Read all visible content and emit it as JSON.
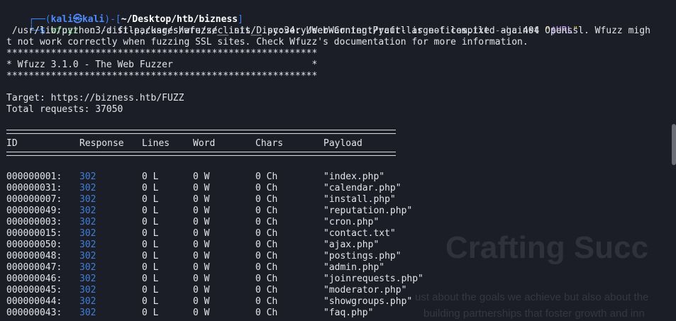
{
  "prompt": {
    "corner_top": "┌──",
    "user": "kali",
    "at": "㉿",
    "host": "kali",
    "dash": "-",
    "path": "~/Desktop/htb/bizness",
    "corner_bottom": "└─",
    "dollar": "$",
    "cmd_name": "wfuzz",
    "flag_c": "-c",
    "flag_z": "-z",
    "wordlist": "file,/usr/share/seclists/Discovery/Web-Content/raft-large-files.txt",
    "flag_hc": "--hc",
    "hc_value": "404",
    "url_quote_open": "\"",
    "url_var": "$URL",
    "url_quote_close": "\""
  },
  "output": {
    "warning_line1": " /usr/lib/python3/dist-packages/wfuzz/__init__.py:34: UserWarning:Pycurl is not compiled against Openssl. Wfuzz migh",
    "warning_line2": "t not work correctly when fuzzing SSL sites. Check Wfuzz's documentation for more information.",
    "banner_stars": "********************************************************",
    "banner_title": "* Wfuzz 3.1.0 - The Web Fuzzer                         *",
    "target": "Target: https://bizness.htb/FUZZ",
    "total": "Total requests: 37050"
  },
  "table": {
    "headers": {
      "id": "ID",
      "response": "Response",
      "lines": "Lines",
      "word": "Word",
      "chars": "Chars",
      "payload": "Payload"
    },
    "rows": [
      {
        "id": "000000001:",
        "response": "302",
        "lines": "0 L",
        "word": "0 W",
        "chars": "0 Ch",
        "payload": "\"index.php\""
      },
      {
        "id": "000000031:",
        "response": "302",
        "lines": "0 L",
        "word": "0 W",
        "chars": "0 Ch",
        "payload": "\"calendar.php\""
      },
      {
        "id": "000000007:",
        "response": "302",
        "lines": "0 L",
        "word": "0 W",
        "chars": "0 Ch",
        "payload": "\"install.php\""
      },
      {
        "id": "000000049:",
        "response": "302",
        "lines": "0 L",
        "word": "0 W",
        "chars": "0 Ch",
        "payload": "\"reputation.php\""
      },
      {
        "id": "000000003:",
        "response": "302",
        "lines": "0 L",
        "word": "0 W",
        "chars": "0 Ch",
        "payload": "\"cron.php\""
      },
      {
        "id": "000000015:",
        "response": "302",
        "lines": "0 L",
        "word": "0 W",
        "chars": "0 Ch",
        "payload": "\"contact.txt\""
      },
      {
        "id": "000000050:",
        "response": "302",
        "lines": "0 L",
        "word": "0 W",
        "chars": "0 Ch",
        "payload": "\"ajax.php\""
      },
      {
        "id": "000000048:",
        "response": "302",
        "lines": "0 L",
        "word": "0 W",
        "chars": "0 Ch",
        "payload": "\"postings.php\""
      },
      {
        "id": "000000047:",
        "response": "302",
        "lines": "0 L",
        "word": "0 W",
        "chars": "0 Ch",
        "payload": "\"admin.php\""
      },
      {
        "id": "000000046:",
        "response": "302",
        "lines": "0 L",
        "word": "0 W",
        "chars": "0 Ch",
        "payload": "\"joinrequests.php\""
      },
      {
        "id": "000000045:",
        "response": "302",
        "lines": "0 L",
        "word": "0 W",
        "chars": "0 Ch",
        "payload": "\"moderator.php\""
      },
      {
        "id": "000000044:",
        "response": "302",
        "lines": "0 L",
        "word": "0 W",
        "chars": "0 Ch",
        "payload": "\"showgroups.php\""
      },
      {
        "id": "000000043:",
        "response": "302",
        "lines": "0 L",
        "word": "0 W",
        "chars": "0 Ch",
        "payload": "\"faq.php\""
      }
    ]
  },
  "background": {
    "title": "Crafting Succ",
    "line1": "ust about the goals we achieve but also about the",
    "line2": "building partnerships that foster growth and inn"
  },
  "colors": {
    "background": "#1b1e27",
    "prompt_blue": "#3b82f6",
    "response_blue": "#3f7fdc",
    "command_green": "#5fd35f",
    "string_orange": "#f1c232"
  }
}
